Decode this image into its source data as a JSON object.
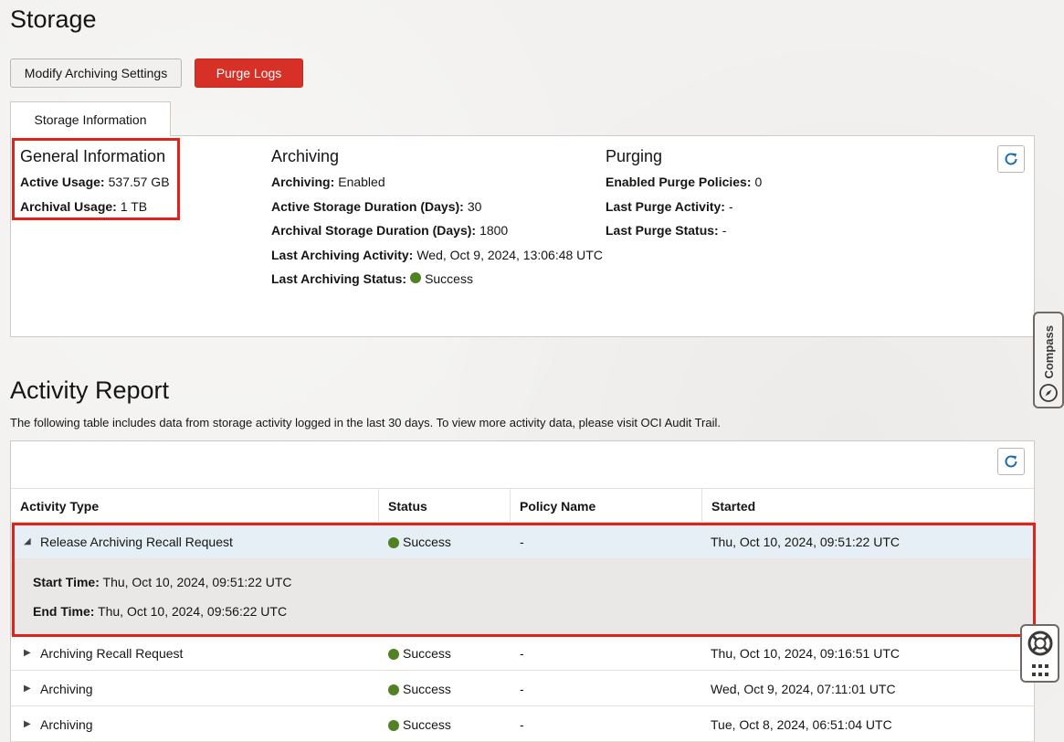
{
  "page": {
    "title": "Storage"
  },
  "toolbar": {
    "modify_label": "Modify Archiving Settings",
    "purge_label": "Purge Logs"
  },
  "tab": {
    "label": "Storage Information"
  },
  "general": {
    "heading": "General Information",
    "active_usage_label": "Active Usage:",
    "active_usage_value": "537.57 GB",
    "archival_usage_label": "Archival Usage:",
    "archival_usage_value": "1 TB"
  },
  "archiving": {
    "heading": "Archiving",
    "archiving_label": "Archiving:",
    "archiving_value": "Enabled",
    "active_duration_label": "Active Storage Duration (Days):",
    "active_duration_value": "30",
    "archival_duration_label": "Archival Storage Duration (Days):",
    "archival_duration_value": "1800",
    "last_activity_label": "Last Archiving Activity:",
    "last_activity_value": "Wed, Oct 9, 2024, 13:06:48 UTC",
    "last_status_label": "Last Archiving Status:",
    "last_status_value": "Success"
  },
  "purging": {
    "heading": "Purging",
    "policies_label": "Enabled Purge Policies:",
    "policies_value": "0",
    "last_activity_label": "Last Purge Activity:",
    "last_activity_value": "-",
    "last_status_label": "Last Purge Status:",
    "last_status_value": "-"
  },
  "activity": {
    "title": "Activity Report",
    "description": "The following table includes data from storage activity logged in the last 30 days. To view more activity data, please visit OCI Audit Trail.",
    "columns": [
      "Activity Type",
      "Status",
      "Policy Name",
      "Started"
    ],
    "rows": [
      {
        "type": "Release Archiving Recall Request",
        "status": "Success",
        "policy": "-",
        "started": "Thu, Oct 10, 2024, 09:51:22 UTC",
        "expanded": true
      },
      {
        "type": "Archiving Recall Request",
        "status": "Success",
        "policy": "-",
        "started": "Thu, Oct 10, 2024, 09:16:51 UTC",
        "expanded": false
      },
      {
        "type": "Archiving",
        "status": "Success",
        "policy": "-",
        "started": "Wed, Oct 9, 2024, 07:11:01 UTC",
        "expanded": false
      },
      {
        "type": "Archiving",
        "status": "Success",
        "policy": "-",
        "started": "Tue, Oct 8, 2024, 06:51:04 UTC",
        "expanded": false
      }
    ],
    "detail": {
      "start_label": "Start Time:",
      "start_value": "Thu, Oct 10, 2024, 09:51:22 UTC",
      "end_label": "End Time:",
      "end_value": "Thu, Oct 10, 2024, 09:56:22 UTC"
    }
  },
  "compass": {
    "label": "Compass"
  },
  "colors": {
    "purge_button": "#d73026",
    "success": "#508223",
    "highlight": "#e0221b",
    "selected_row": "#e5eff5",
    "refresh_icon": "#1b6ca8"
  },
  "icons": [
    "refresh-icon",
    "compass-icon",
    "caret-down-icon",
    "caret-right-icon",
    "lifebuoy-icon",
    "grid-icon"
  ]
}
